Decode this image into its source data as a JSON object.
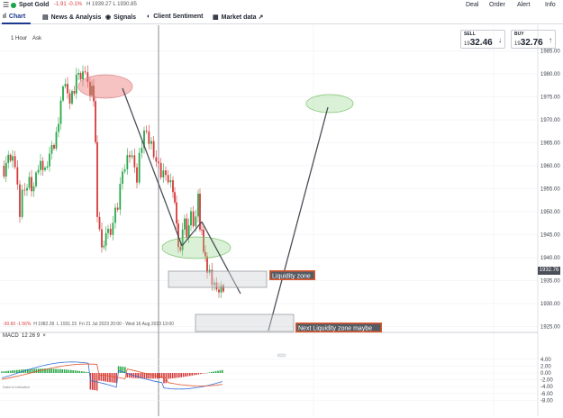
{
  "topbar": {
    "menu_icon": "hamburger-menu-icon",
    "symbol": "Spot Gold",
    "change": "-1.91 -0.1%",
    "high_low": "H 1939.27 L 1930.85",
    "actions": [
      "Deal",
      "Order",
      "Alert",
      "Info"
    ]
  },
  "tabs": [
    {
      "icon": "chart-icon",
      "label": "Chart",
      "active": true
    },
    {
      "icon": "news-icon",
      "label": "News & Analysis"
    },
    {
      "icon": "signals-icon",
      "label": "Signals"
    },
    {
      "icon": "sentiment-icon",
      "label": "Client Sentiment"
    },
    {
      "icon": "market-data-icon",
      "label": "Market data ↗"
    }
  ],
  "toolbar": {
    "timeframe": "1 Hour",
    "price_type": "Ask"
  },
  "quotes": {
    "sell": {
      "label": "SELL",
      "small": "19",
      "big": "32.46"
    },
    "buy": {
      "label": "BUY",
      "small": "19",
      "big": "32.76"
    }
  },
  "price_axis": {
    "ticks": [
      "1985.00",
      "1980.00",
      "1975.00",
      "1970.00",
      "1965.00",
      "1960.00",
      "1955.00",
      "1950.00",
      "1945.00",
      "1940.00",
      "1935.00",
      "1930.00",
      "1925.00"
    ],
    "current_price": "1932.76"
  },
  "annotations": {
    "liquidity_zone": "Liquidity zone",
    "next_liquidity_zone": "Next Liquidity zone maybe"
  },
  "info_line": {
    "change": "-30.60 -1.56%",
    "high": "H 1982.39",
    "low": "L 1931.15",
    "range": "Fri 21 Jul 2023 20:00 - Wed 16 Aug 2023 13:00"
  },
  "macd": {
    "label": "MACD",
    "params": "12  26  9",
    "ticks": [
      "4.00",
      "2.00",
      "0.00",
      "-2.00",
      "-4.00",
      "-6.00",
      "-8.00"
    ]
  },
  "footer": {
    "credit": "Data is indicative"
  },
  "colors": {
    "up": "#2aa84a",
    "down": "#d63a3a",
    "accent": "#1b3a8f",
    "label_bg": "#e0552a"
  }
}
